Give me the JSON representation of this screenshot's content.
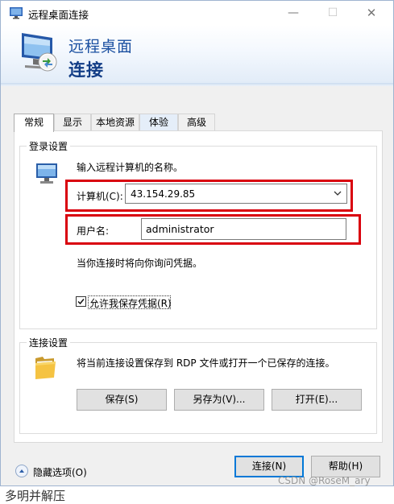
{
  "window": {
    "title": "远程桌面连接",
    "controls": {
      "minimize": "—",
      "maximize": "☐",
      "close": "✕"
    }
  },
  "banner": {
    "line1": "远程桌面",
    "line2": "连接"
  },
  "tabs": [
    {
      "label": "常规",
      "active": true
    },
    {
      "label": "显示"
    },
    {
      "label": "本地资源"
    },
    {
      "label": "体验"
    },
    {
      "label": "高级"
    }
  ],
  "login": {
    "group_title": "登录设置",
    "instruction": "输入远程计算机的名称。",
    "computer_label": "计算机(C):",
    "computer_value": "43.154.29.85",
    "username_label": "用户名:",
    "username_value": "administrator",
    "credential_note": "当你连接时将向你询问凭据。",
    "save_credentials_label": "允许我保存凭据(R)",
    "save_credentials_checked": true
  },
  "connection": {
    "group_title": "连接设置",
    "description": "将当前连接设置保存到 RDP 文件或打开一个已保存的连接。",
    "save_button": "保存(S)",
    "save_as_button": "另存为(V)...",
    "open_button": "打开(E)..."
  },
  "footer": {
    "hide_options": "隐藏选项(O)",
    "connect_button": "连接(N)",
    "help_button": "帮助(H)"
  },
  "watermark": "CSDN @RoseM_ary",
  "stray_text": "多明并解压",
  "colors": {
    "highlight_box": "#d9000d",
    "primary_border": "#0078d7",
    "banner_title": "#1a4fa0"
  }
}
